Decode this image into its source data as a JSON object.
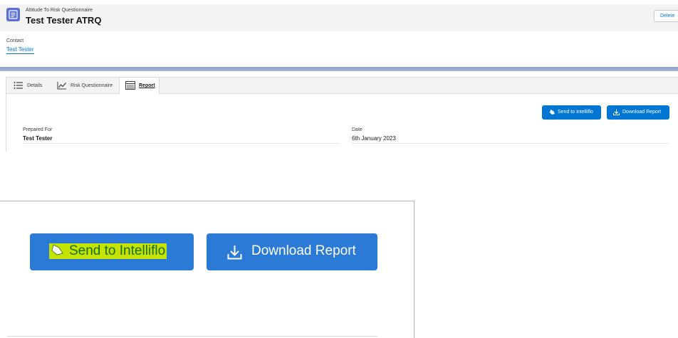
{
  "record": {
    "object_type": "Attitude To Risk Questionnaire",
    "title": "Test Tester ATRQ",
    "icon": "record-icon"
  },
  "actions": {
    "delete_label": "Delete"
  },
  "contact": {
    "label": "Contact",
    "value": "Test Tester"
  },
  "tabs": [
    {
      "label": "Details",
      "icon": "list-icon"
    },
    {
      "label": "Risk Questionnaire",
      "icon": "line-chart-icon"
    },
    {
      "label": "Report",
      "icon": "report-table-icon",
      "active": true
    }
  ],
  "report": {
    "send_label": "Send to Intelliflo",
    "download_label": "Download Report",
    "prepared_for_label": "Prepared For",
    "prepared_for_value": "Test Tester",
    "date_label": "Date",
    "date_value": "6th January 2023"
  },
  "zoom": {
    "send_label": "Send to Intelliflo",
    "download_label": "Download Report",
    "highlight_color": "#c5e300"
  },
  "colors": {
    "brand_blue": "#0176d3",
    "record_icon": "#5a70d8"
  }
}
